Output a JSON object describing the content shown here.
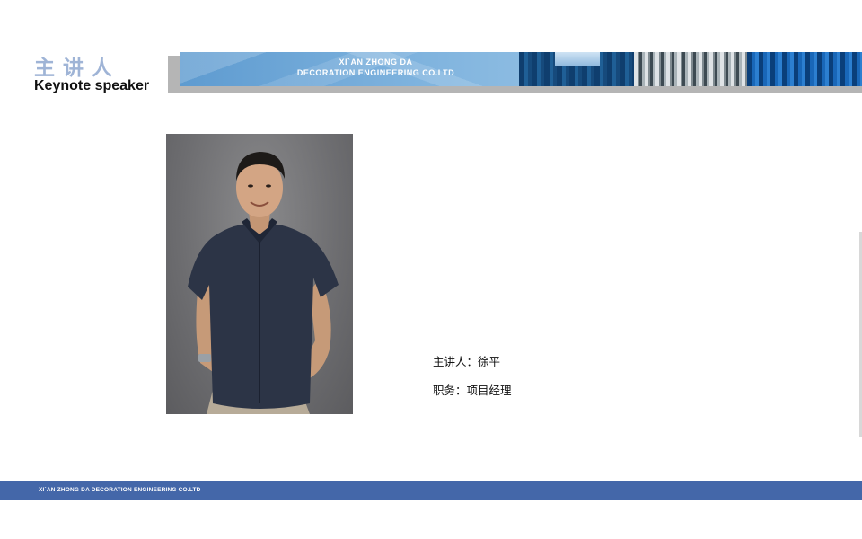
{
  "header": {
    "title_cn": "主讲人",
    "title_en": "Keynote speaker"
  },
  "banner": {
    "line1": "XI`AN ZHONG DA",
    "line2": "DECORATION ENGINEERING CO.LTD"
  },
  "speaker": {
    "presenter": "主讲人：徐平",
    "position": "职务：项目经理"
  },
  "footer": {
    "company": "XI`AN ZHONG DA DECORATION ENGINEERING CO.LTD"
  },
  "colors": {
    "title_cn": "#9fb4d6",
    "footer_bar": "#4467a9"
  }
}
